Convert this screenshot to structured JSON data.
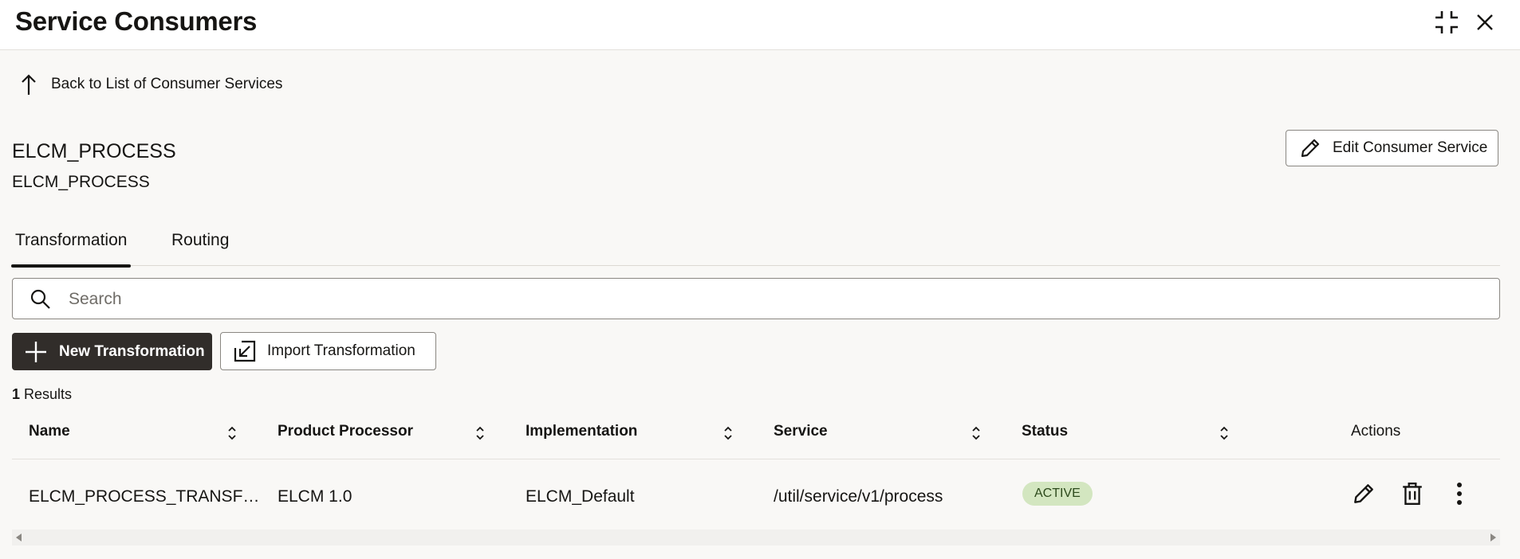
{
  "header": {
    "title": "Service Consumers"
  },
  "back_link": {
    "label": "Back to List of Consumer Services"
  },
  "consumer_service": {
    "name": "ELCM_PROCESS",
    "description": "ELCM_PROCESS",
    "edit_label": "Edit Consumer Service"
  },
  "tabs": [
    {
      "label": "Transformation",
      "active": true
    },
    {
      "label": "Routing",
      "active": false
    }
  ],
  "search": {
    "placeholder": "Search",
    "value": ""
  },
  "toolbar": {
    "new_label": "New Transformation",
    "import_label": "Import Transformation"
  },
  "results": {
    "count": "1",
    "label": "Results"
  },
  "table": {
    "columns": [
      "Name",
      "Product Processor",
      "Implementation",
      "Service",
      "Status",
      "Actions"
    ],
    "rows": [
      {
        "name": "ELCM_PROCESS_TRANSF…",
        "product_processor": "ELCM 1.0",
        "implementation": "ELCM_Default",
        "service": "/util/service/v1/process",
        "status": "ACTIVE"
      }
    ]
  },
  "icons": {
    "header": [
      "collapse-icon",
      "close-icon"
    ],
    "row_actions": [
      "edit-icon",
      "delete-icon",
      "more-vertical-icon"
    ]
  },
  "colors": {
    "primary_button": "#312d2a",
    "status_active_bg": "#d3e6c0",
    "status_active_text": "#2d4a1c"
  }
}
